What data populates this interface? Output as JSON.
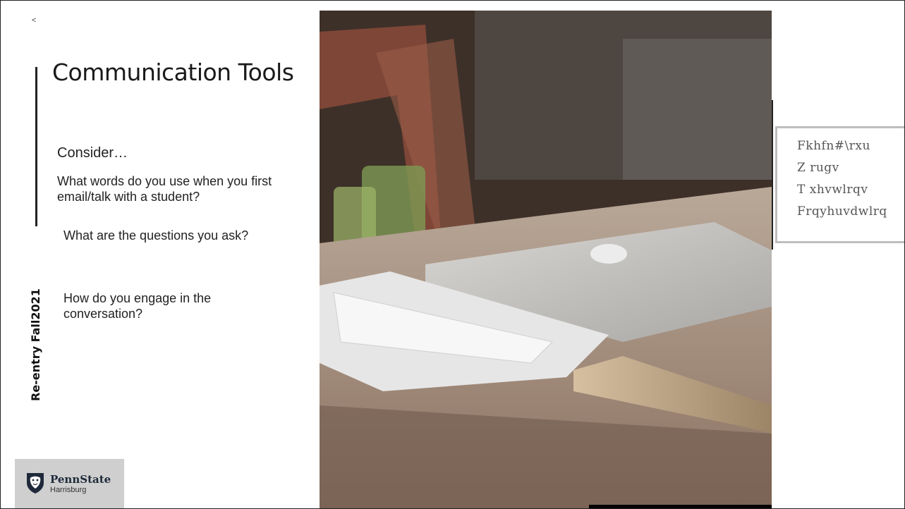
{
  "slide": {
    "back_arrow": "<",
    "title": "Communication Tools",
    "consider": "Consider…",
    "questions": [
      "What words do you use when you first email/talk with a student?",
      "What are the questions you ask?",
      "How do you engage in the conversation?"
    ],
    "side_label": "Re-entry Fall2021"
  },
  "logo": {
    "name": "PennState",
    "sub": "Harrisburg"
  },
  "code_box": {
    "lines": [
      "Fkhfn#\\rxu",
      "Z rugv",
      "T xhvwlrqv",
      "Frqyhuvdwlrq"
    ]
  },
  "colors": {
    "logo_bg": "#cfcfcf",
    "code_text": "#555555",
    "accent_line": "#222222"
  }
}
